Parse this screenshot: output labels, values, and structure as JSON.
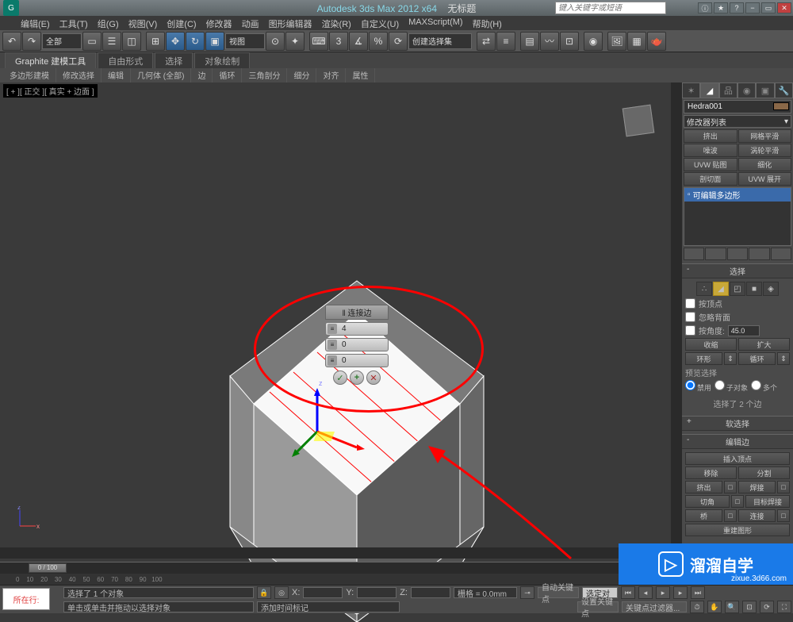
{
  "title": {
    "app": "Autodesk 3ds Max 2012 x64",
    "doc": "无标题"
  },
  "search_placeholder": "键入关键字或短语",
  "menu": [
    "编辑(E)",
    "工具(T)",
    "组(G)",
    "视图(V)",
    "创建(C)",
    "修改器",
    "动画",
    "图形编辑器",
    "渲染(R)",
    "自定义(U)",
    "MAXScript(M)",
    "帮助(H)"
  ],
  "toolbar": {
    "all": "全部",
    "view": "视图",
    "selset": "创建选择集"
  },
  "ribbon": {
    "tabs": [
      "Graphite 建模工具",
      "自由形式",
      "选择",
      "对象绘制"
    ],
    "sub": [
      "多边形建模",
      "修改选择",
      "编辑",
      "几何体 (全部)",
      "边",
      "循环",
      "三角剖分",
      "细分",
      "对齐",
      "属性"
    ]
  },
  "viewport": {
    "label": "[ + ][ 正交 ][ 真实 + 边面 ]"
  },
  "connect": {
    "title": "‖ 连接边",
    "v1": "4",
    "v2": "0",
    "v3": "0"
  },
  "cmd": {
    "obj_name": "Hedra001",
    "mod_list": "修改器列表",
    "mods": [
      "挤出",
      "网格平滑",
      "噪波",
      "涡轮平滑",
      "UVW 贴图",
      "细化",
      "剖切面",
      "UVW 展开"
    ],
    "stack_item": "可编辑多边形",
    "r_select": "选择",
    "byvertex": "按顶点",
    "ignoreback": "忽略背面",
    "byangle": "按角度:",
    "angle": "45.0",
    "shrink": "收缩",
    "grow": "扩大",
    "ring": "环形",
    "loop": "循环",
    "preview_lbl": "预览选择",
    "prev_opts": [
      "禁用",
      "子对象",
      "多个"
    ],
    "sel_info": "选择了 2 个边",
    "r_soft": "软选择",
    "r_edge": "编辑边",
    "insert_v": "插入顶点",
    "remove": "移除",
    "split": "分割",
    "extrude": "挤出",
    "weld": "焊接",
    "chamfer": "切角",
    "target_weld": "目标焊接",
    "bridge": "桥",
    "connect": "连接",
    "create_shape": "重建图形"
  },
  "timeline": {
    "handle": "0 / 100"
  },
  "status": {
    "sel": "选择了 1 个对象",
    "hint": "单击或单击并拖动以选择对象",
    "x": "X:",
    "y": "Y:",
    "z": "Z:",
    "grid": "栅格 = 0.0mm",
    "addtime": "添加时间标记",
    "autokey": "自动关键点",
    "setkey": "设置关键点",
    "selset2": "选定对",
    "keyfilter": "关键点过滤器...",
    "prompt": "所在行:"
  },
  "watermark": {
    "main": "溜溜自学",
    "sub": "zixue.3d66.com"
  }
}
